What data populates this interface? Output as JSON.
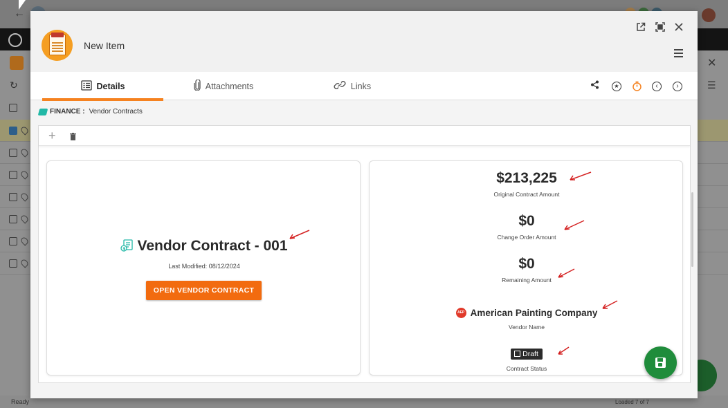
{
  "background": {
    "status_text": "Ready",
    "loaded_text": "Loaded 7 of 7"
  },
  "modal": {
    "title": "New Item",
    "tabs": [
      {
        "label": "Details",
        "active": true
      },
      {
        "label": "Attachments",
        "active": false
      },
      {
        "label": "Links",
        "active": false
      }
    ],
    "breadcrumb": {
      "module": "FINANCE :",
      "page": "Vendor Contracts"
    },
    "left_card": {
      "title": "Vendor Contract - 001",
      "last_modified": "Last Modified: 08/12/2024",
      "open_button": "OPEN VENDOR CONTRACT"
    },
    "right_card": {
      "original_amount": {
        "value": "$213,225",
        "label": "Original Contract Amount"
      },
      "change_order_amount": {
        "value": "$0",
        "label": "Change Order Amount"
      },
      "remaining_amount": {
        "value": "$0",
        "label": "Remaining Amount"
      },
      "vendor": {
        "name": "American Painting Company",
        "label": "Vendor Name",
        "logo_text": "AEP"
      },
      "status": {
        "value": "Draft",
        "label": "Contract Status"
      }
    }
  },
  "colors": {
    "accent_orange": "#f58220",
    "button_orange": "#f26b0f",
    "save_green": "#1f8c3b",
    "annotation_red": "#d42020",
    "teal_icon": "#21b8a6"
  },
  "icons": [
    "external-link-icon",
    "fullscreen-icon",
    "close-icon",
    "menu-icon",
    "details-icon",
    "paperclip-icon",
    "link-icon",
    "share-icon",
    "star-icon",
    "timer-icon",
    "chevron-left-icon",
    "chevron-right-icon",
    "plus-icon",
    "trash-icon",
    "save-icon"
  ]
}
